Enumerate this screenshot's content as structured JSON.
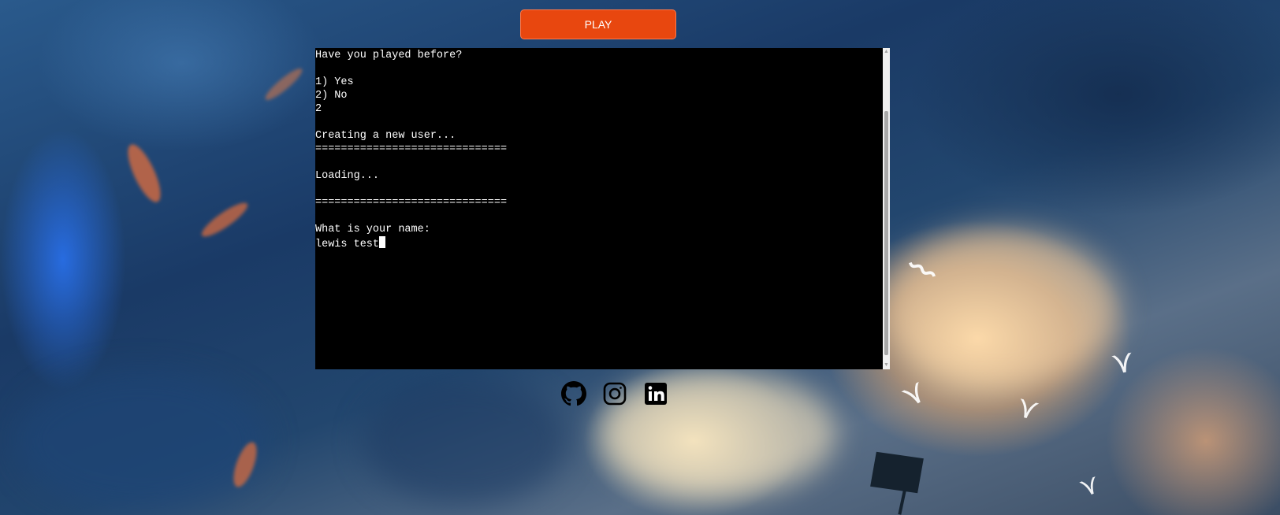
{
  "header": {
    "play_label": "PLAY"
  },
  "terminal": {
    "lines": [
      "Have you played before?",
      "",
      "1) Yes",
      "2) No",
      "2",
      "",
      "Creating a new user...",
      "==============================",
      "",
      "Loading...",
      "",
      "==============================",
      "",
      "What is your name:"
    ],
    "input_value": "lewis test"
  },
  "social_links": [
    {
      "icon": "github-icon"
    },
    {
      "icon": "instagram-icon"
    },
    {
      "icon": "linkedin-icon"
    }
  ],
  "colors": {
    "play_button": "#e8470f",
    "terminal_bg": "#000000",
    "terminal_text": "#ffffff"
  }
}
